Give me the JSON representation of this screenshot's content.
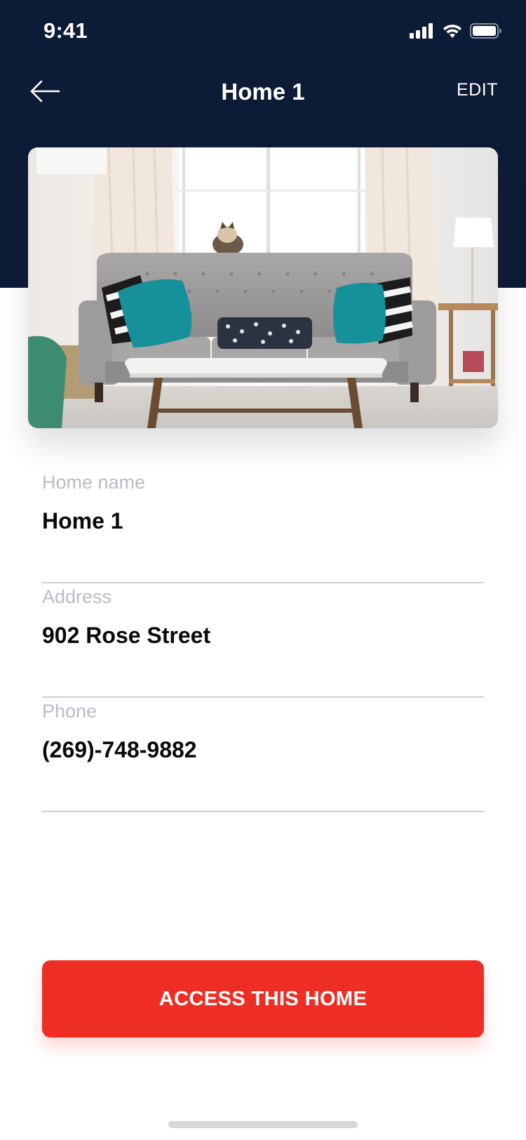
{
  "status_bar": {
    "time": "9:41"
  },
  "header": {
    "title": "Home 1",
    "edit_label": "EDIT",
    "background_color": "#0e1b36"
  },
  "photo": {
    "subject": "living-room-sofa-photo"
  },
  "form": {
    "fields": [
      {
        "label": "Home name",
        "value": "Home 1"
      },
      {
        "label": "Address",
        "value": "902 Rose Street"
      },
      {
        "label": "Phone",
        "value": "(269)-748-9882"
      }
    ]
  },
  "actions": {
    "access_label": "ACCESS THIS HOME",
    "access_color": "#ee2e24"
  },
  "icons": {
    "back": "arrow-left-icon",
    "signal": "cellular-signal-icon",
    "wifi": "wifi-icon",
    "battery": "battery-icon"
  }
}
